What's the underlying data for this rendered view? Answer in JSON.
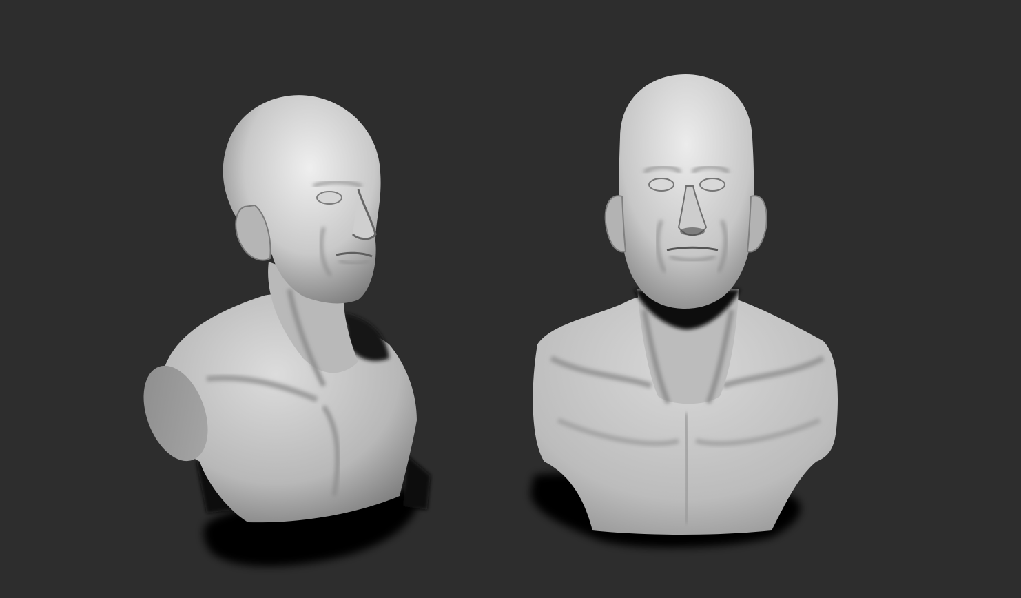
{
  "viewport": {
    "background_color": "#2d2d2d",
    "material_color": "#bdbdbd",
    "shadow_color": "#050505"
  },
  "sculpts": [
    {
      "name": "bust-three-quarter-view",
      "view": "three-quarter"
    },
    {
      "name": "bust-front-view",
      "view": "front"
    }
  ]
}
